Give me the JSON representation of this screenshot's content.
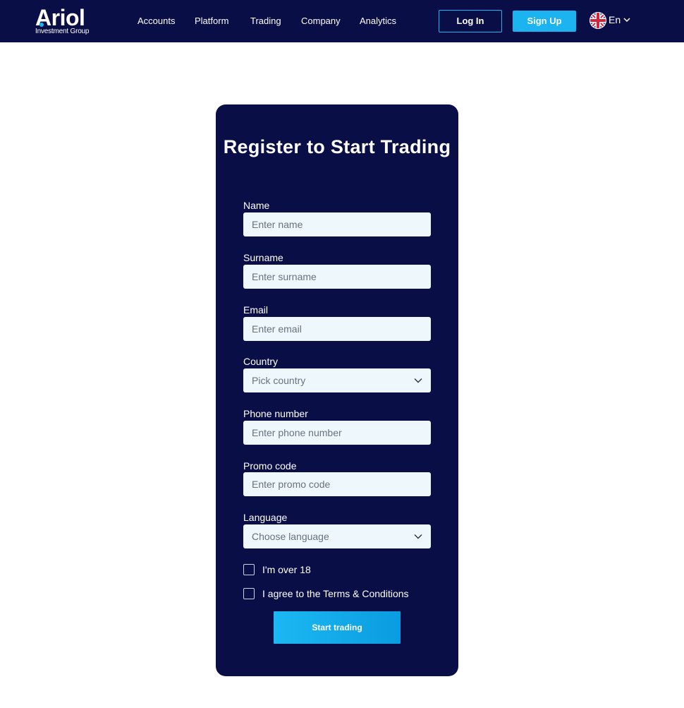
{
  "brand": {
    "name": "Ariol",
    "subtitle": "Investment Group",
    "accent_color": "#1bb4f0",
    "dark_color": "#0a0e47"
  },
  "nav": {
    "items": [
      {
        "label": "Accounts"
      },
      {
        "label": "Platform"
      },
      {
        "label": "Trading"
      },
      {
        "label": "Company"
      },
      {
        "label": "Analytics"
      }
    ],
    "login_label": "Log In",
    "signup_label": "Sign Up",
    "language": {
      "label": "En",
      "flag_icon": "uk-flag-icon"
    }
  },
  "form": {
    "title": "Register to Start Trading",
    "fields": {
      "name": {
        "label": "Name",
        "placeholder": "Enter name",
        "value": ""
      },
      "surname": {
        "label": "Surname",
        "placeholder": "Enter surname",
        "value": ""
      },
      "email": {
        "label": "Email",
        "placeholder": "Enter email",
        "value": ""
      },
      "country": {
        "label": "Country",
        "selected": "Pick country"
      },
      "phone": {
        "label": "Phone number",
        "placeholder": "Enter phone number",
        "value": ""
      },
      "promo": {
        "label": "Promo code",
        "placeholder": "Enter promo code",
        "value": ""
      },
      "language": {
        "label": "Language",
        "selected": "Choose language"
      }
    },
    "checkboxes": {
      "age": {
        "label": "I'm over 18",
        "checked": false
      },
      "terms": {
        "label": "I agree to the Terms & Conditions",
        "checked": false
      }
    },
    "submit_label": "Start trading"
  }
}
